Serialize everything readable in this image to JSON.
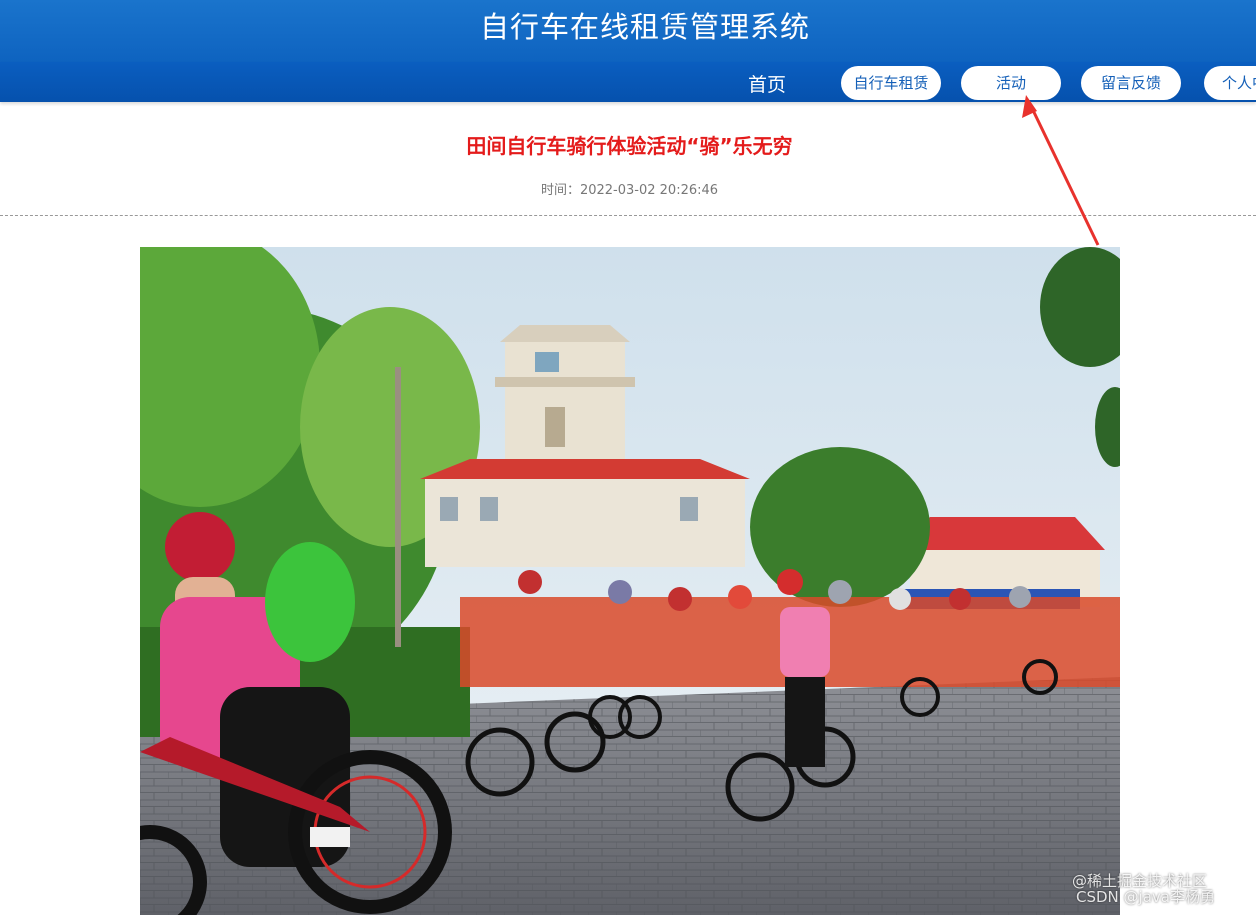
{
  "header": {
    "site_title": "自行车在线租赁管理系统"
  },
  "nav": {
    "home": "首页",
    "items": [
      {
        "label": "自行车租赁"
      },
      {
        "label": "活动"
      },
      {
        "label": "留言反馈"
      },
      {
        "label": "个人中心"
      }
    ]
  },
  "article": {
    "title": "田间自行车骑行体验活动“骑”乐无穷",
    "time_label": "时间：",
    "time_value": "2022-03-02 20:26:46",
    "image_alt": "photo-of-cyclists"
  },
  "annotation": {
    "arrow_color": "#e8322d"
  },
  "watermark": {
    "line1": "@稀土掘金技术社区",
    "line2": "CSDN @java李杨勇"
  },
  "colors": {
    "brand_blue": "#0e63c0",
    "title_red": "#e41b1b",
    "pill_text": "#1560b8"
  }
}
